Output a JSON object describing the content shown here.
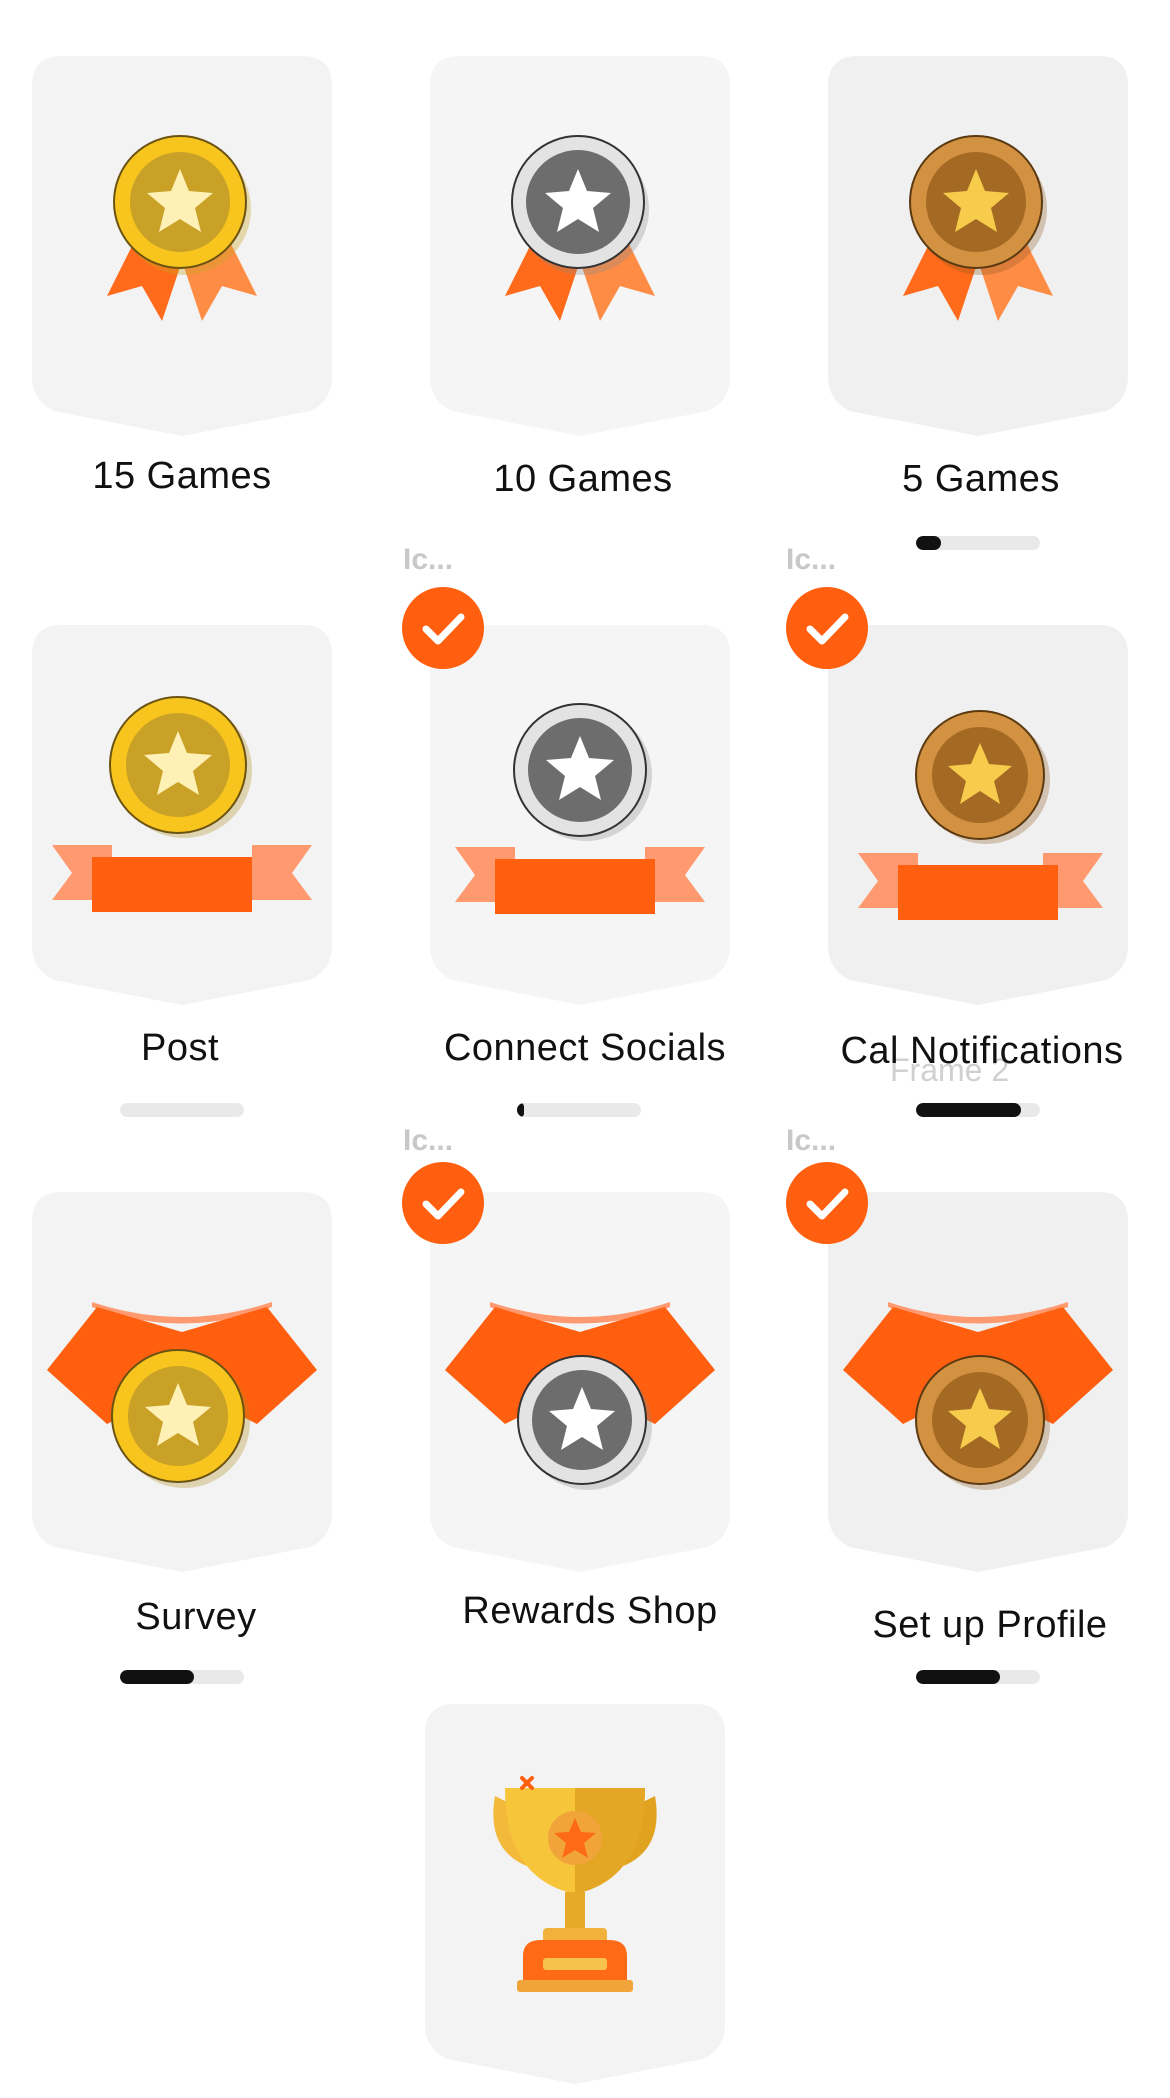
{
  "badges": [
    {
      "title": "15 Games",
      "metal": "gold",
      "style": "rosette"
    },
    {
      "title": "10 Games",
      "metal": "silver",
      "style": "rosette"
    },
    {
      "title": "5 Games",
      "metal": "bronze",
      "style": "rosette",
      "progress": 0.2
    },
    {
      "title": "Post",
      "metal": "gold",
      "style": "banner",
      "progress": 0
    },
    {
      "title": "Connect Socials",
      "metal": "silver",
      "style": "banner",
      "progress": 0.05,
      "completed": true,
      "icon_label": "Ic..."
    },
    {
      "title": "Cal Notifications",
      "metal": "bronze",
      "style": "banner",
      "progress": 0.85,
      "completed": true,
      "icon_label": "Ic...",
      "overlay_text": "Frame 2"
    },
    {
      "title": "Survey",
      "metal": "gold",
      "style": "collar",
      "progress": 0.6
    },
    {
      "title": "Rewards Shop",
      "metal": "silver",
      "style": "collar",
      "completed": true,
      "icon_label": "Ic..."
    },
    {
      "title": "Set up Profile",
      "metal": "bronze",
      "style": "collar",
      "progress": 0.68,
      "completed": true,
      "icon_label": "Ic..."
    },
    {
      "title": "",
      "style": "trophy"
    }
  ],
  "colors": {
    "accent": "#ff5f0f",
    "shield": "#f3f3f3",
    "gold": "#f3c21b",
    "silver": "#c9c9c9",
    "bronze": "#c98a3a",
    "progress_track": "#e9e9e9",
    "progress_fill": "#111111"
  },
  "icons": {
    "check": "check-icon",
    "star": "star-icon",
    "trophy": "trophy-icon"
  }
}
